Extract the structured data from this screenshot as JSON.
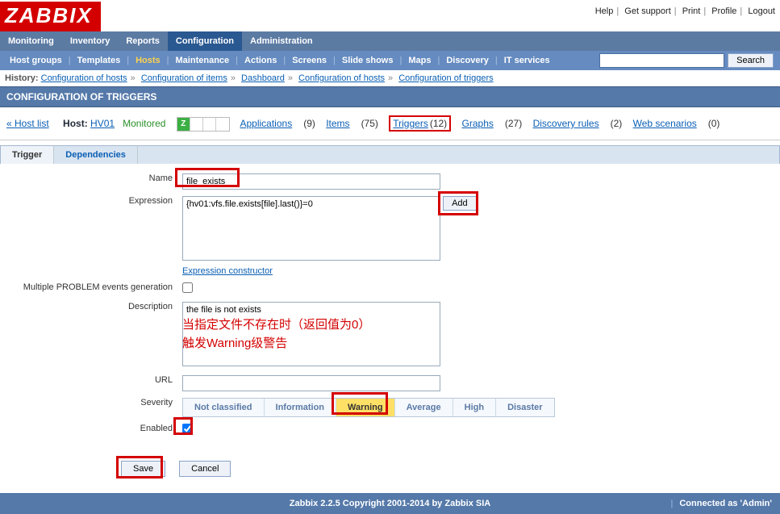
{
  "toplinks": {
    "help": "Help",
    "support": "Get support",
    "print": "Print",
    "profile": "Profile",
    "logout": "Logout"
  },
  "mainnav": {
    "monitoring": "Monitoring",
    "inventory": "Inventory",
    "reports": "Reports",
    "configuration": "Configuration",
    "administration": "Administration"
  },
  "subnav": {
    "hostgroups": "Host groups",
    "templates": "Templates",
    "hosts": "Hosts",
    "maintenance": "Maintenance",
    "actions": "Actions",
    "screens": "Screens",
    "slideshows": "Slide shows",
    "maps": "Maps",
    "discovery": "Discovery",
    "itservices": "IT services",
    "searchbtn": "Search"
  },
  "history": {
    "label": "History:",
    "items": [
      "Configuration of hosts",
      "Configuration of items",
      "Dashboard",
      "Configuration of hosts",
      "Configuration of triggers"
    ]
  },
  "pageheader": "CONFIGURATION OF TRIGGERS",
  "hostbar": {
    "backlink": "« Host list",
    "hostlabel": "Host:",
    "hostname": "HV01",
    "status": "Monitored",
    "links": {
      "applications": {
        "label": "Applications",
        "count": "(9)"
      },
      "items": {
        "label": "Items",
        "count": "(75)"
      },
      "triggers": {
        "label": "Triggers",
        "count": "(12)"
      },
      "graphs": {
        "label": "Graphs",
        "count": "(27)"
      },
      "discovery": {
        "label": "Discovery rules",
        "count": "(2)"
      },
      "web": {
        "label": "Web scenarios",
        "count": "(0)"
      }
    }
  },
  "tabs": {
    "trigger": "Trigger",
    "dependencies": "Dependencies"
  },
  "form": {
    "name_label": "Name",
    "name_value": "file_exists",
    "expr_label": "Expression",
    "expr_value": "{hv01:vfs.file.exists[file].last()}=0",
    "add_btn": "Add",
    "exprconstr": "Expression constructor",
    "multi_label": "Multiple PROBLEM events generation",
    "desc_label": "Description",
    "desc_value": "the file is not exists",
    "url_label": "URL",
    "url_value": "",
    "sev_label": "Severity",
    "sev_opts": [
      "Not classified",
      "Information",
      "Warning",
      "Average",
      "High",
      "Disaster"
    ],
    "sev_selected": "Warning",
    "enabled_label": "Enabled"
  },
  "annotation": {
    "line1": "当指定文件不存在时（返回值为0）",
    "line2": "触发Warning级警告"
  },
  "buttons": {
    "save": "Save",
    "cancel": "Cancel"
  },
  "footer": {
    "center": "Zabbix 2.2.5 Copyright 2001-2014 by Zabbix SIA",
    "right": "Connected as 'Admin'"
  },
  "logo": "ZABBIX"
}
